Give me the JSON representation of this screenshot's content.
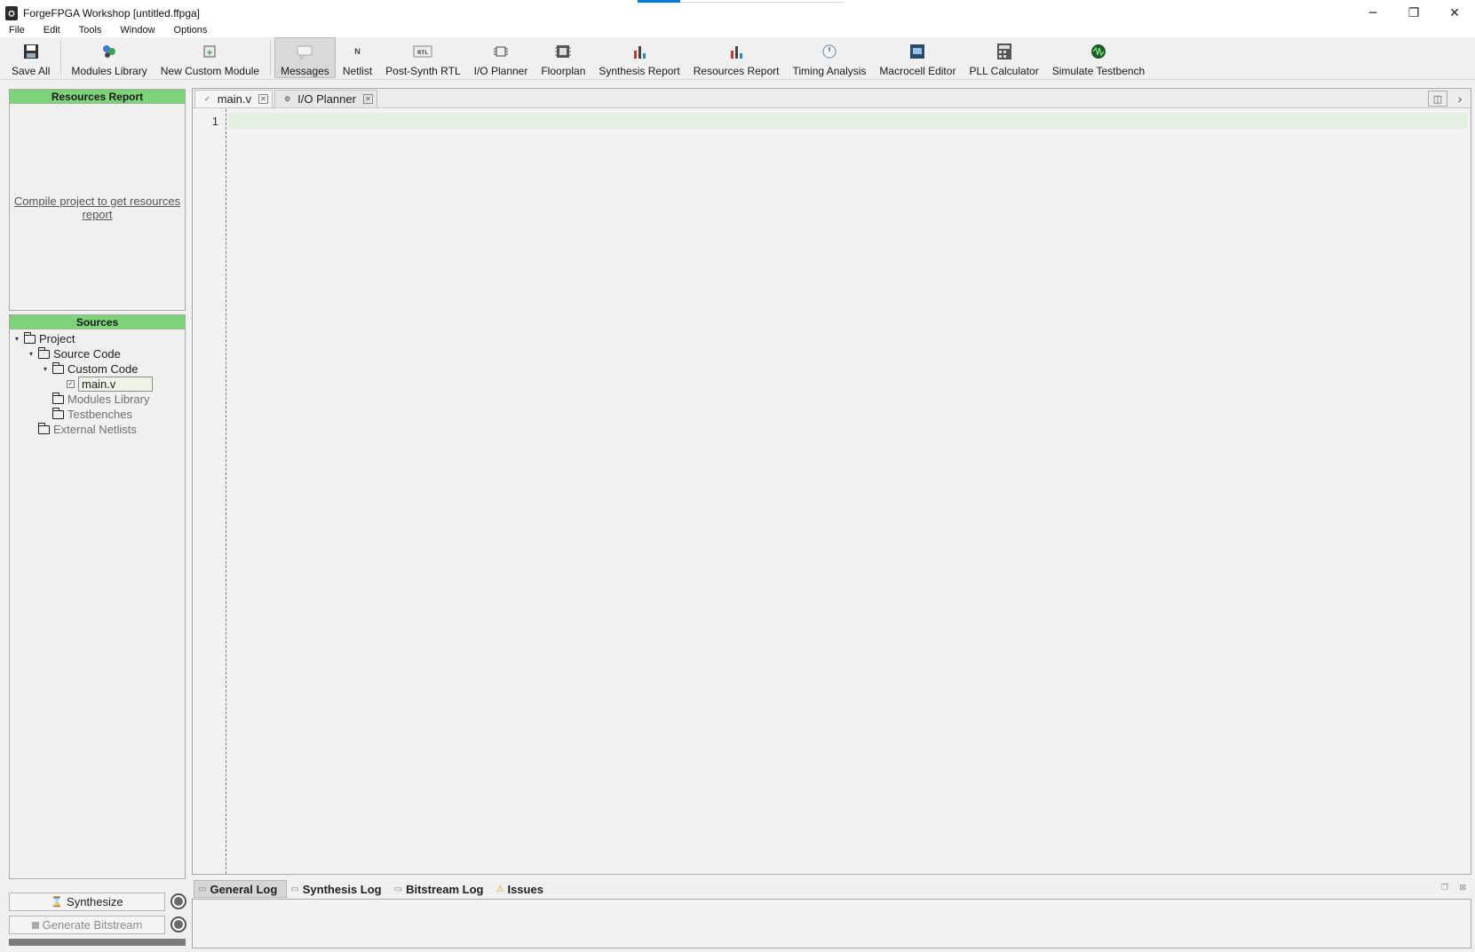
{
  "window": {
    "title": "ForgeFPGA Workshop [untitled.ffpga]",
    "minimize_glyph": "─",
    "restore_glyph": "❐",
    "close_glyph": "✕"
  },
  "menu": [
    "File",
    "Edit",
    "Tools",
    "Window",
    "Options"
  ],
  "toolbar": [
    {
      "label": "Save All",
      "icon": "save-icon"
    },
    {
      "label": "Modules Library",
      "icon": "modules-library-icon"
    },
    {
      "label": "New Custom Module",
      "icon": "new-custom-module-icon"
    },
    {
      "label": "Messages",
      "icon": "messages-icon",
      "active": true
    },
    {
      "label": "Netlist",
      "icon": "netlist-icon"
    },
    {
      "label": "Post-Synth RTL",
      "icon": "rtl-icon"
    },
    {
      "label": "I/O Planner",
      "icon": "io-planner-icon"
    },
    {
      "label": "Floorplan",
      "icon": "floorplan-icon"
    },
    {
      "label": "Synthesis Report",
      "icon": "synthesis-report-icon"
    },
    {
      "label": "Resources Report",
      "icon": "resources-report-icon"
    },
    {
      "label": "Timing Analysis",
      "icon": "timing-analysis-icon"
    },
    {
      "label": "Macrocell Editor",
      "icon": "macrocell-editor-icon"
    },
    {
      "label": "PLL Calculator",
      "icon": "pll-calculator-icon"
    },
    {
      "label": "Simulate Testbench",
      "icon": "simulate-testbench-icon"
    }
  ],
  "resources_panel": {
    "title": "Resources Report",
    "link": "Compile project to get resources report"
  },
  "sources_panel": {
    "title": "Sources",
    "tree": [
      {
        "label": "Project",
        "depth": 0,
        "expanded": true,
        "type": "folder"
      },
      {
        "label": "Source Code",
        "depth": 1,
        "expanded": true,
        "type": "folder"
      },
      {
        "label": "Custom Code",
        "depth": 2,
        "expanded": true,
        "type": "folder"
      },
      {
        "label": "main.v",
        "depth": 3,
        "type": "file",
        "editing": true
      },
      {
        "label": "Modules Library",
        "depth": 2,
        "type": "folder",
        "dim": true
      },
      {
        "label": "Testbenches",
        "depth": 2,
        "type": "folder",
        "dim": true
      },
      {
        "label": "External Netlists",
        "depth": 1,
        "type": "folder",
        "dim": true
      }
    ]
  },
  "actions": {
    "synthesize": "Synthesize",
    "generate_bitstream": "Generate Bitstream"
  },
  "editor": {
    "tabs": [
      {
        "label": "main.v",
        "active": true
      },
      {
        "label": "I/O Planner",
        "active": false
      }
    ],
    "line_numbers": [
      "1"
    ]
  },
  "log": {
    "tabs": [
      {
        "label": "General Log",
        "active": true
      },
      {
        "label": "Synthesis Log",
        "active": false
      },
      {
        "label": "Bitstream Log",
        "active": false
      },
      {
        "label": "Issues",
        "active": false,
        "icon": "warning-icon"
      }
    ]
  },
  "colors": {
    "panel_header": "#7ed37a",
    "current_line": "#e5efdf",
    "accent": "#0078d4"
  }
}
